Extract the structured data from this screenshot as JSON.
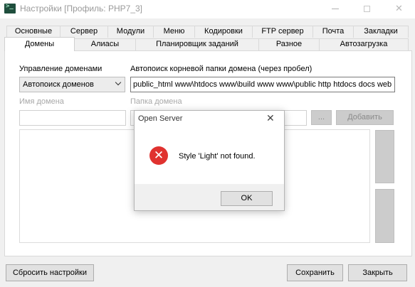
{
  "window": {
    "title": "Настройки [Профиль: PHP7_3]",
    "minimize_icon": "minimize-icon",
    "maximize_icon": "maximize-icon",
    "close_glyph": "✕"
  },
  "tabs_row1": [
    "Основные",
    "Сервер",
    "Модули",
    "Меню",
    "Кодировки",
    "FTP сервер",
    "Почта",
    "Закладки"
  ],
  "tabs_row2": [
    "Домены",
    "Алиасы",
    "Планировщик заданий",
    "Разное",
    "Автозагрузка"
  ],
  "active_tab": "Домены",
  "domains": {
    "mode_label": "Управление доменами",
    "mode_value": "Автопоиск доменов",
    "autosearch_label": "Автопоиск корневой папки домена (через пробел)",
    "autosearch_value": "public_html www\\htdocs www\\build www www\\public http htdocs docs web",
    "domain_name_label": "Имя домена",
    "domain_name_value": "",
    "domain_folder_label": "Папка домена",
    "domain_folder_value": "",
    "browse_label": "...",
    "add_label": "Добавить"
  },
  "dialog": {
    "title": "Open Server",
    "close_glyph": "✕",
    "icon": "error-icon",
    "message": "Style 'Light' not found.",
    "ok_label": "OK"
  },
  "footer": {
    "reset_label": "Сбросить настройки",
    "save_label": "Сохранить",
    "close_label": "Закрыть"
  }
}
